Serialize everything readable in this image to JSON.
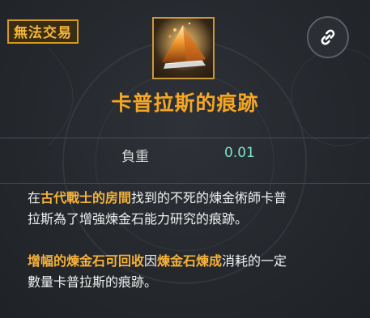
{
  "tag_label": "無法交易",
  "item_icon": "alchemy-stone-pyramid-icon",
  "link_icon": "link-icon",
  "title": "卡普拉斯的痕跡",
  "stats": {
    "weight_label": "負重",
    "weight_value": "0.01"
  },
  "description": {
    "line1": [
      {
        "text": "在",
        "highlight": false
      },
      {
        "text": "古代戰士的房間",
        "highlight": true
      },
      {
        "text": "找到的不死的煉金術師卡普",
        "highlight": false
      }
    ],
    "line2": [
      {
        "text": "拉斯為了增強煉金石能力研究的痕跡。",
        "highlight": false
      }
    ],
    "line3": [
      {
        "text": "增幅的煉金石可回收",
        "highlight": true
      },
      {
        "text": "因",
        "highlight": false
      },
      {
        "text": "煉金石煉成",
        "highlight": true
      },
      {
        "text": "消耗的一定",
        "highlight": false
      }
    ],
    "line4": [
      {
        "text": "數量卡普拉斯的痕跡。",
        "highlight": false
      }
    ]
  },
  "colors": {
    "title": "#f5a623",
    "highlight": "#f5b23a",
    "value": "#7fe3d4",
    "tag_border": "#d79a1c"
  }
}
